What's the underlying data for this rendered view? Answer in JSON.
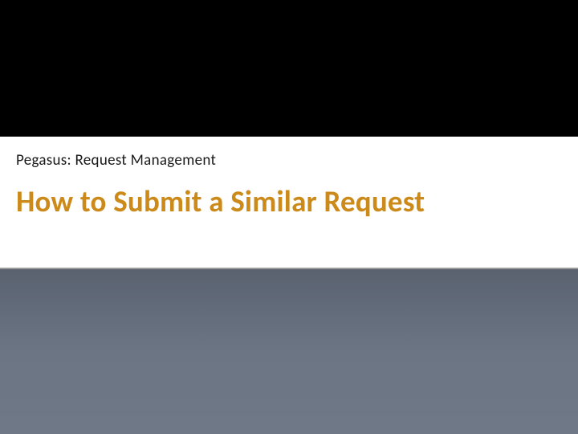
{
  "slide": {
    "subtitle": "Pegasus: Request Management",
    "title": "How to Submit a Similar Request"
  }
}
